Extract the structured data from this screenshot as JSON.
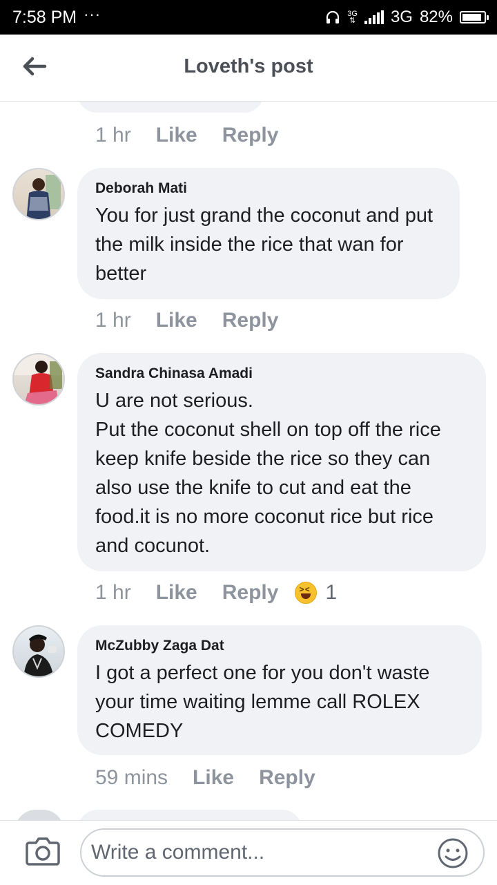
{
  "status_bar": {
    "time": "7:58 PM",
    "dots": "···",
    "network_top": "3G",
    "network_bottom": "⇅",
    "network_type": "3G",
    "battery": "82%"
  },
  "header": {
    "title": "Loveth's post",
    "back_icon": "back-arrow-icon"
  },
  "previous_actions": {
    "time": "1 hr",
    "like": "Like",
    "reply": "Reply"
  },
  "comments": [
    {
      "author": "Deborah Mati",
      "text": "You for just grand the coconut and put the milk inside the rice that wan for better",
      "time": "1 hr",
      "like": "Like",
      "reply": "Reply"
    },
    {
      "author": "Sandra Chinasa Amadi",
      "lines": [
        "U are not serious.",
        "Put the coconut shell on top off the rice keep knife beside the rice so they can also use the knife to cut and eat the food.it is no more coconut rice but rice and cocunot."
      ],
      "time": "1 hr",
      "like": "Like",
      "reply": "Reply",
      "reaction": {
        "icon": "laughing-emoji-icon",
        "count": "1"
      }
    },
    {
      "author": "McZubby Zaga Dat",
      "text": "I got a perfect one for you don't waste your time waiting lemme call ROLEX COMEDY",
      "time": "59 mins",
      "like": "Like",
      "reply": "Reply"
    }
  ],
  "composer": {
    "placeholder": "Write a comment...",
    "camera_icon": "camera-icon",
    "emoji_icon": "smiley-icon"
  },
  "colors": {
    "bubble": "#f0f2f5",
    "meta_text": "#8d949e",
    "header_text": "#4b4f56"
  }
}
